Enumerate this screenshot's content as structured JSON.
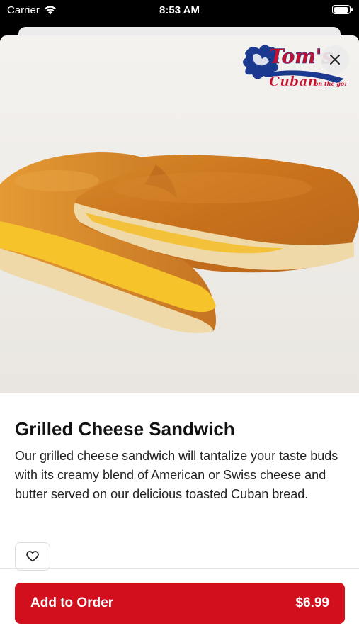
{
  "status_bar": {
    "carrier": "Carrier",
    "time": "8:53 AM"
  },
  "logo": {
    "line1": "Tom's",
    "line2": "Cuban",
    "tagline": "on the go!"
  },
  "item": {
    "title": "Grilled Cheese Sandwich",
    "description": "Our grilled cheese sandwich will tantalize your taste buds with its creamy blend of American or Swiss cheese and butter served on our delicious toasted Cuban bread.",
    "image": "grilled-cheese-sandwich-photo"
  },
  "actions": {
    "add_label": "Add to Order",
    "price": "$6.99",
    "favorite_icon": "heart-icon",
    "close_icon": "close-icon"
  },
  "colors": {
    "accent": "#d10f1d",
    "logo_blue": "#1b3a8f",
    "logo_red": "#c8102e"
  }
}
